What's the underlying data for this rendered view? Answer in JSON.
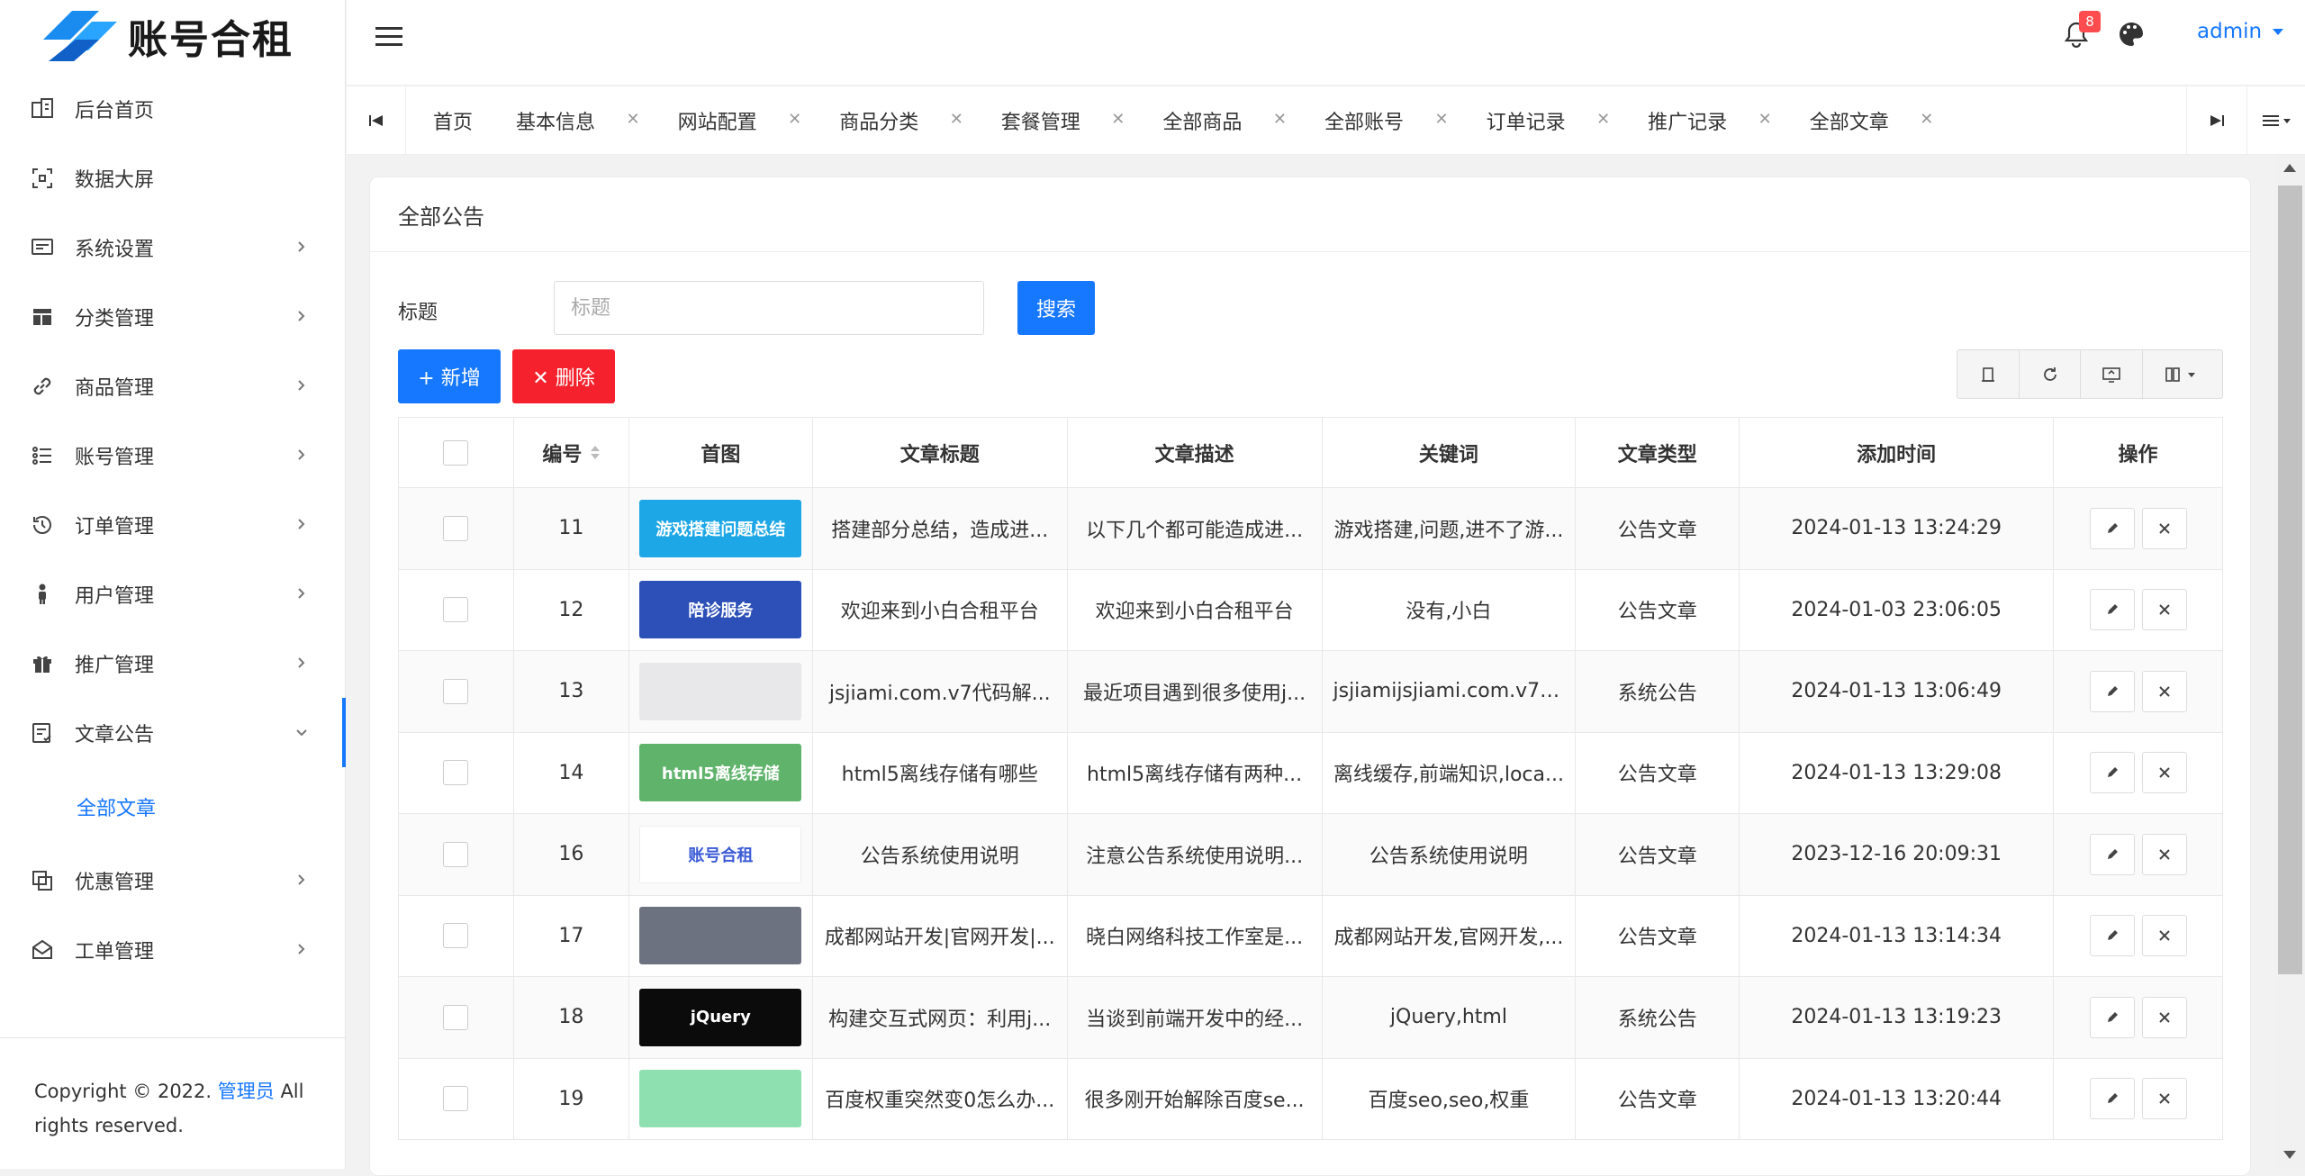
{
  "brand": {
    "name": "账号合租",
    "colors": {
      "accent": "#1677ff",
      "danger": "#f5222d"
    }
  },
  "sidebar": {
    "items": [
      {
        "label": "后台首页",
        "icon": "dashboard-icon",
        "has_children": false
      },
      {
        "label": "数据大屏",
        "icon": "screen-icon",
        "has_children": false
      },
      {
        "label": "系统设置",
        "icon": "settings-icon",
        "has_children": true
      },
      {
        "label": "分类管理",
        "icon": "category-icon",
        "has_children": true
      },
      {
        "label": "商品管理",
        "icon": "link-icon",
        "has_children": true
      },
      {
        "label": "账号管理",
        "icon": "list-icon",
        "has_children": true
      },
      {
        "label": "订单管理",
        "icon": "history-icon",
        "has_children": true
      },
      {
        "label": "用户管理",
        "icon": "user-icon",
        "has_children": true
      },
      {
        "label": "推广管理",
        "icon": "gift-icon",
        "has_children": true
      },
      {
        "label": "文章公告",
        "icon": "article-icon",
        "has_children": true,
        "expanded": true
      },
      {
        "label": "优惠管理",
        "icon": "coupon-icon",
        "has_children": true
      },
      {
        "label": "工单管理",
        "icon": "ticket-icon",
        "has_children": true
      }
    ],
    "active_sub": "全部文章",
    "footer": {
      "prefix": "Copyright © 2022. ",
      "link": "管理员",
      "suffix": " All rights reserved."
    }
  },
  "header": {
    "notification_count": "8",
    "user": "admin"
  },
  "tabs": [
    {
      "label": "首页",
      "closable": false
    },
    {
      "label": "基本信息",
      "closable": true
    },
    {
      "label": "网站配置",
      "closable": true
    },
    {
      "label": "商品分类",
      "closable": true
    },
    {
      "label": "套餐管理",
      "closable": true
    },
    {
      "label": "全部商品",
      "closable": true
    },
    {
      "label": "全部账号",
      "closable": true
    },
    {
      "label": "订单记录",
      "closable": true
    },
    {
      "label": "推广记录",
      "closable": true
    },
    {
      "label": "全部文章",
      "closable": true
    }
  ],
  "main": {
    "title": "全部公告",
    "filter": {
      "label": "标题",
      "placeholder": "标题",
      "search_label": "搜索"
    },
    "actions": {
      "add_label": "+ 新增",
      "delete_label": "✕ 删除"
    }
  },
  "table": {
    "headers": [
      "编号",
      "首图",
      "文章标题",
      "文章描述",
      "关键词",
      "文章类型",
      "添加时间",
      "操作"
    ],
    "rows": [
      {
        "id": "11",
        "thumb": {
          "text": "游戏搭建问题总结",
          "bg": "#1ea7e6",
          "fg": "#ffffff"
        },
        "title": "搭建部分总结，造成进...",
        "desc": "以下几个都可能造成进...",
        "keywords": "游戏搭建,问题,进不了游...",
        "type": "公告文章",
        "time": "2024-01-13 13:24:29"
      },
      {
        "id": "12",
        "thumb": {
          "text": "陪诊服务",
          "bg": "#2c4fb8",
          "fg": "#ffffff"
        },
        "title": "欢迎来到小白合租平台",
        "desc": "欢迎来到小白合租平台",
        "keywords": "没有,小白",
        "type": "公告文章",
        "time": "2024-01-03 23:06:05"
      },
      {
        "id": "13",
        "thumb": {
          "text": "",
          "bg": "#e8e8ea",
          "fg": "#333333"
        },
        "title": "jsjiami.com.v7代码解...",
        "desc": "最近项目遇到很多使用j...",
        "keywords": "jsjiamijsjiami.com.v7J...",
        "type": "系统公告",
        "time": "2024-01-13 13:06:49"
      },
      {
        "id": "14",
        "thumb": {
          "text": "html5离线存储",
          "bg": "#5fb36b",
          "fg": "#ffffff"
        },
        "title": "html5离线存储有哪些",
        "desc": "html5离线存储有两种...",
        "keywords": "离线缓存,前端知识,loca...",
        "type": "公告文章",
        "time": "2024-01-13 13:29:08"
      },
      {
        "id": "16",
        "thumb": {
          "text": "账号合租",
          "bg": "#ffffff",
          "fg": "#3b5bd6"
        },
        "title": "公告系统使用说明",
        "desc": "注意公告系统使用说明...",
        "keywords": "公告系统使用说明",
        "type": "公告文章",
        "time": "2023-12-16 20:09:31"
      },
      {
        "id": "17",
        "thumb": {
          "text": "",
          "bg": "#6d7280",
          "fg": "#ffffff"
        },
        "title": "成都网站开发|官网开发|...",
        "desc": "晓白网络科技工作室是...",
        "keywords": "成都网站开发,官网开发,...",
        "type": "公告文章",
        "time": "2024-01-13 13:14:34"
      },
      {
        "id": "18",
        "thumb": {
          "text": "jQuery",
          "bg": "#0b0b0b",
          "fg": "#ffffff"
        },
        "title": "构建交互式网页：利用j...",
        "desc": "当谈到前端开发中的经...",
        "keywords": "jQuery,html",
        "type": "系统公告",
        "time": "2024-01-13 13:19:23"
      },
      {
        "id": "19",
        "thumb": {
          "text": "",
          "bg": "#8fe0b0",
          "fg": "#ffffff"
        },
        "title": "百度权重突然变0怎么办...",
        "desc": "很多刚开始解除百度se...",
        "keywords": "百度seo,seo,权重",
        "type": "公告文章",
        "time": "2024-01-13 13:20:44"
      }
    ]
  }
}
